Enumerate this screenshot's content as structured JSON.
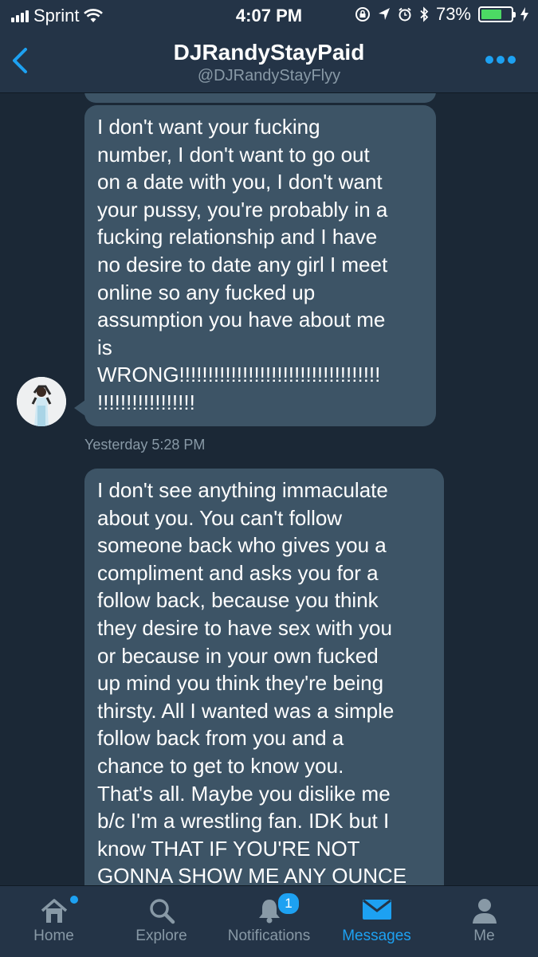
{
  "status_bar": {
    "carrier": "Sprint",
    "time": "4:07 PM",
    "battery_percent": "73%",
    "battery_level": 0.73,
    "icons": [
      "signal-icon",
      "wifi-icon",
      "lock-rotation-icon",
      "location-icon",
      "alarm-icon",
      "bluetooth-icon",
      "battery-icon",
      "charging-icon"
    ]
  },
  "header": {
    "title": "DJRandyStayPaid",
    "handle": "@DJRandyStayFlyy",
    "accent_color": "#1da1f2"
  },
  "messages": [
    {
      "text": "I don't want your fucking\nnumber, I don't want to go out\non a date with you, I don't want\nyour pussy, you're probably in a\nfucking relationship and I have\nno desire to date any girl I meet\nonline so any fucked up\nassumption you have about me\nis\nWRONG!!!!!!!!!!!!!!!!!!!!!!!!!!!!!!!!!!!\n!!!!!!!!!!!!!!!!!",
      "timestamp": "Yesterday 5:28 PM"
    },
    {
      "text": "I don't see anything immaculate\nabout you. You can't follow\nsomeone back who gives you a\ncompliment and asks you for a\nfollow back, because you think\nthey desire to have sex with you\nor because in your own fucked\nup mind you think they're being\nthirsty. All I wanted was a simple\nfollow back from you and a\nchance to get to know you.\nThat's all. Maybe you dislike me\nb/c I'm a wrestling fan. IDK but I\nknow THAT IF YOU'RE NOT\nGONNA SHOW ME ANY OUNCE"
    }
  ],
  "tabs": [
    {
      "label": "Home",
      "icon": "home-icon",
      "has_dot": true
    },
    {
      "label": "Explore",
      "icon": "search-icon"
    },
    {
      "label": "Notifications",
      "icon": "bell-icon",
      "badge": "1"
    },
    {
      "label": "Messages",
      "icon": "envelope-icon",
      "active": true
    },
    {
      "label": "Me",
      "icon": "person-icon"
    }
  ]
}
